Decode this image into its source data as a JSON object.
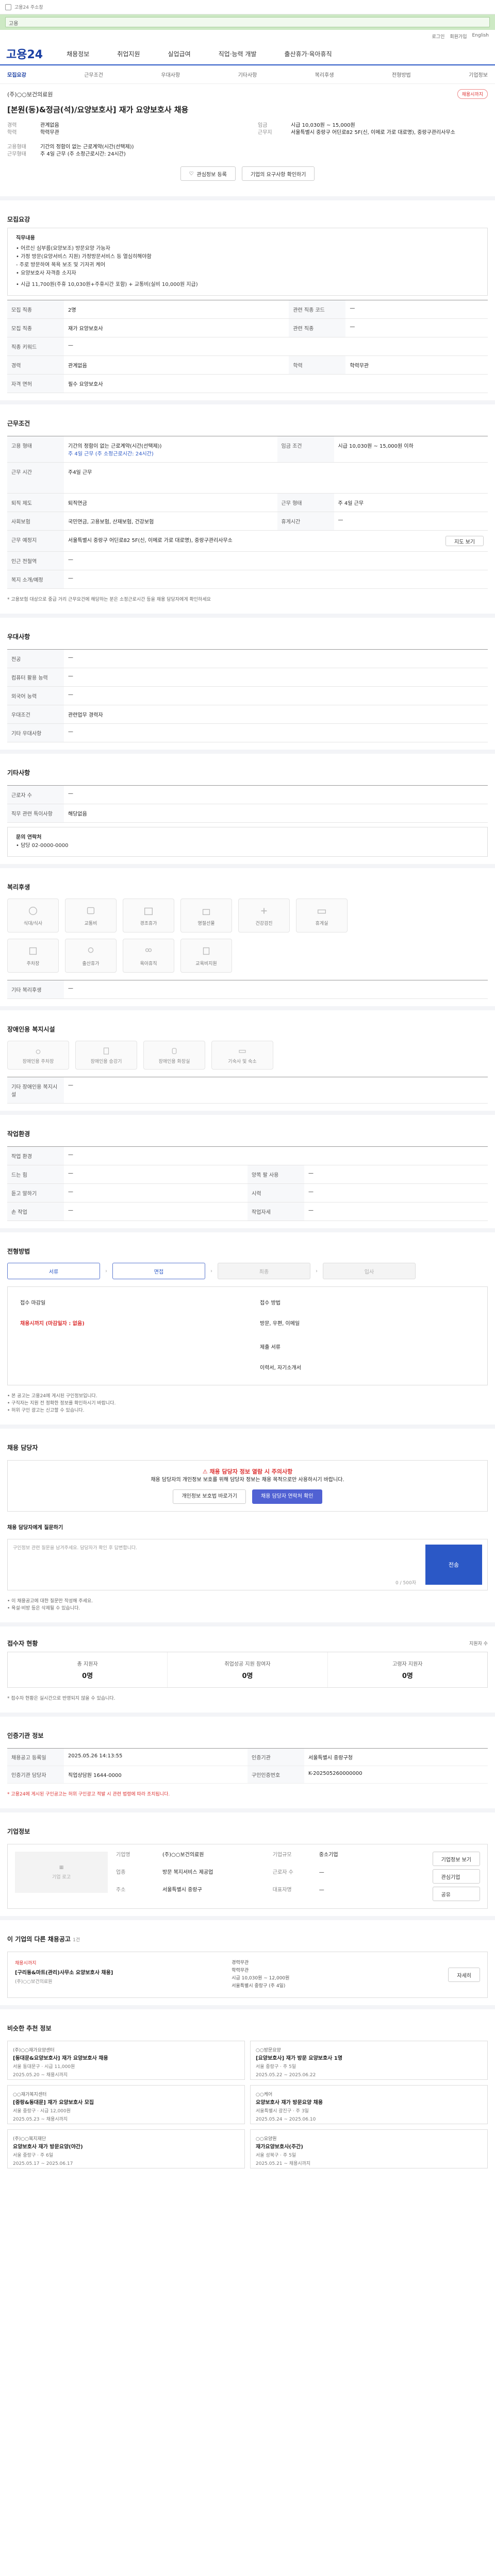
{
  "topbar": {
    "label": "고용24 주소창"
  },
  "green": {
    "text": "고용"
  },
  "util": {
    "items": [
      "로그인",
      "회원가입",
      "English"
    ]
  },
  "gnb": {
    "logo": "고용24",
    "menu": [
      "채용정보",
      "취업지원",
      "실업급여",
      "직업·능력 개발",
      "출산휴가·육아휴직"
    ]
  },
  "subtabs": {
    "items": [
      "모집요강",
      "근무조건",
      "우대사항",
      "기타사항",
      "복리후생",
      "전형방법",
      "기업정보"
    ]
  },
  "header": {
    "company": "(주)○○보건의료원",
    "badge": "채용시까지",
    "title": "[본원(동)&정금(석)/요양보호사] 재가 요양보호사 채용"
  },
  "summary": {
    "left": [
      {
        "k": "경력",
        "v": "관계없음"
      },
      {
        "k": "학력",
        "v": "학력무관"
      },
      {
        "k": "고용형태",
        "v": "기간의 정함이 없는 근로계약(시간(선택제))"
      },
      {
        "k": "근무형태",
        "v": "주 4일 근무 (주 소정근로시간: 24시간)"
      }
    ],
    "right": [
      {
        "k": "임금",
        "v": "시급 10,030원 ~ 15,000원"
      },
      {
        "k": "근무지",
        "v": "서울특별시 중랑구 어딘로82 5F(신, 이메로 가로 대로명), 중랑구관리사무소"
      }
    ]
  },
  "buttons": {
    "save": "관심정보 등록",
    "share": "기업의 요구사항 확인하기"
  },
  "recruit": {
    "title": "모집요강",
    "duty_title": "직무내용",
    "duty_lines": [
      "• 어르신 심부름(요양보조) 방문요양 가능자",
      "• 가정 방문(요양서비스 지원) 가정방문서비스 등 열심히해야함",
      "- 주로 방문하여 목욕 보조 및 기저귀 케어",
      "• 요양보호사 자격증 소지자",
      "• 시급 11,700원(주휴 10,030원+주휴시간 포함) + 교통비(실비 10,000원 지급)"
    ],
    "rows": [
      {
        "k": "모집 직종",
        "v": "2명",
        "k2": "관련 직종 코드",
        "v2": "—"
      },
      {
        "k": "모집 직종",
        "v": "재가 요양보호사",
        "k2": "관련 직종",
        "v2": "—"
      },
      {
        "k": "직종 키워드",
        "v": "—",
        "k2": "",
        "v2": ""
      },
      {
        "k": "경력",
        "v": "관계없음",
        "k2": "학력",
        "v2": "학력무관"
      },
      {
        "k": "자격 면허",
        "v": "필수  요양보호사",
        "k2": "",
        "v2": ""
      }
    ]
  },
  "workcond": {
    "title": "근무조건",
    "rows": [
      {
        "k": "고용 형태",
        "v": "기간의 정함이 없는 근로계약(시간(선택제))",
        "k2": "임금 조건",
        "v2": "시급 10,030원 ~ 15,000원 이하"
      },
      {
        "k": "",
        "v": "주 4일 근무 (주 소정근로시간: 24시간)",
        "k2": "",
        "v2": ""
      },
      {
        "k": "근무 시간",
        "v": "주4일 근무",
        "k2": "",
        "v2": ""
      },
      {
        "k": "퇴직 제도",
        "v": "퇴직연금",
        "k2": "근무 형태",
        "v2": "주 4일 근무"
      },
      {
        "k": "사회보험",
        "v": "국민연금, 고용보험, 산재보험, 건강보험",
        "k2": "휴게시간",
        "v2": "—"
      },
      {
        "k": "근무 예정지",
        "v": "서울특별시 중랑구 어딘로82 5F(신, 이메로 가로 대로명), 중랑구관리사무소",
        "k2": "",
        "v2": "지도 보기"
      },
      {
        "k": "인근 전철역",
        "v": "—",
        "k2": "",
        "v2": ""
      },
      {
        "k": "복지 소개/예정",
        "v": "—",
        "k2": "",
        "v2": ""
      }
    ],
    "note": "* 고용보험 대상으로 중급 거리 근무요건에 해당하는 분은 소정근로시간 등을 채용 담당자에게 확인하세요"
  },
  "pref": {
    "title": "우대사항",
    "rows": [
      {
        "k": "전공",
        "v": "—"
      },
      {
        "k": "컴퓨터 활용 능력",
        "v": "—"
      },
      {
        "k": "외국어 능력",
        "v": "—"
      },
      {
        "k": "우대조건",
        "v": "관련업무 경력자"
      },
      {
        "k": "기타 우대사항",
        "v": "—"
      }
    ]
  },
  "etc": {
    "title": "기타사항",
    "rows": [
      {
        "k": "근로자 수",
        "v": "—"
      },
      {
        "k": "직무 관련 특이사항",
        "v": "해당없음"
      }
    ],
    "contact_label": "문의 연락처",
    "contact": "• 담당 02-0000-0000"
  },
  "welfare": {
    "title": "복리후생",
    "items": [
      "식대/식사",
      "교통비",
      "경조휴가",
      "명절선물",
      "건강검진",
      "휴게실",
      "주차장",
      "출산휴가",
      "육아휴직",
      "교육비지원",
      "",
      ""
    ],
    "extra_label": "기타 복리후생",
    "extra": "—"
  },
  "disable": {
    "title": "장애인용 복지시설",
    "items": [
      "장애인용 주차장",
      "장애인용 승강기",
      "장애인용 화장실",
      "기숙사 및 숙소"
    ],
    "extra_label": "기타 장애인용 복지시설",
    "extra": "—"
  },
  "workenv": {
    "title": "작업환경",
    "rows": [
      {
        "k": "작업 환경",
        "v": "—",
        "k2": "",
        "v2": ""
      },
      {
        "k": "드는 힘",
        "v": "—",
        "k2": "양쪽 팔 사용",
        "v2": "—"
      },
      {
        "k": "듣고 말하기",
        "v": "—",
        "k2": "시력",
        "v2": "—"
      },
      {
        "k": "손 작업",
        "v": "—",
        "k2": "작업자세",
        "v2": "—"
      }
    ]
  },
  "screen": {
    "title": "전형방법",
    "steps": [
      "서류",
      "면접",
      "최종",
      "입사"
    ],
    "deadline_label": "접수 마감일",
    "deadline": "채용시까지 (마감일자 : 없음)",
    "method_label": "접수 방법",
    "method": "방문, 우편, 이메일",
    "docs_label": "제출 서류",
    "docs": "이력서, 자기소개서",
    "notes": [
      "• 본 공고는 고용24에 게시된 구인정보입니다.",
      "• 구직자는 지원 전 정확한 정보를 확인하시기 바랍니다.",
      "• 허위 구인 광고는 신고할 수 있습니다."
    ]
  },
  "contact": {
    "title": "채용 담당자",
    "alert": "채용 담당자 정보 열람 시 주의사항",
    "alert_body": "채용 담당자의 개인정보 보호를 위해 담당자 정보는 채용 목적으로만 사용하시기 바랍니다.",
    "btn1": "개인정보 보호법 바로가기",
    "btn2": "채용 담당자 연락처 확인"
  },
  "inquiry": {
    "title": "채용 담당자에게 질문하기",
    "placeholder": "구인정보 관련 질문을 남겨주세요. 담당자가 확인 후 답변합니다.",
    "counter": "0 / 500자",
    "send": "전송",
    "notes": [
      "• 이 채용공고에 대한 질문만 작성해 주세요.",
      "• 욕설·비방 등은 삭제될 수 있습니다."
    ]
  },
  "status": {
    "title": "접수자 현황",
    "more": "지원자 수",
    "items": [
      {
        "k": "총 지원자",
        "v": "0명"
      },
      {
        "k": "취업성공 지원 참여자",
        "v": "0명"
      },
      {
        "k": "고령자 지원자",
        "v": "0명"
      }
    ],
    "note": "* 접수자 현황은 실시간으로 반영되지 않을 수 있습니다."
  },
  "reginfo": {
    "title": "인증기관 정보",
    "rows": [
      {
        "k": "채용공고 등록일",
        "v": "2025.05.26 14:13:55",
        "k2": "인증기관",
        "v2": "서울특별시 중랑구청"
      },
      {
        "k": "인증기관 담당자",
        "v": "직업상담원 1644-0000",
        "k2": "구인인증번호",
        "v2": "K-202505260000000"
      }
    ],
    "note": "* 고용24에 게시된 구인공고는 허위 구인광고 적발 시 관련 법령에 따라 조치됩니다."
  },
  "company": {
    "title": "기업정보",
    "logo_label": "기업 로고",
    "name_k": "기업명",
    "name_v": "(주)○○보건의료원",
    "biz_k": "업종",
    "biz_v": "방문 복지서비스 제공업",
    "size_k": "기업규모",
    "size_v": "중소기업",
    "emp_k": "근로자 수",
    "emp_v": "—",
    "addr_k": "주소",
    "addr_v": "서울특별시 중랑구",
    "rep_k": "대표자명",
    "rep_v": "—",
    "btn1": "기업정보 보기",
    "btn2": "관심기업",
    "btn3": "공유"
  },
  "other": {
    "title": "이 기업의 다른 채용공고",
    "count": "1건",
    "co": "(주)○○보건의료원",
    "label": "채용시까지",
    "job": "[구리동&마트(관리)사무소 요양보호사 채용]",
    "meta": [
      "경력무관",
      "학력무관",
      "시급 10,030원 ~ 12,000원",
      "서울특별시 중랑구 (주 4일)"
    ],
    "btn": "자세히"
  },
  "recs": {
    "title": "비슷한 추천 정보",
    "items": [
      {
        "co": "(주)○○재가요양센터",
        "t": "[동대문&요양보호사] 재가 요양보호사 채용",
        "m": "서울 동대문구 · 시급 11,000원",
        "d": "2025.05.20 ~ 채용시까지"
      },
      {
        "co": "○○방문요양",
        "t": "[요양보호사] 재가 방문 요양보호사 1명",
        "m": "서울 중랑구 · 주 5일",
        "d": "2025.05.22 ~ 2025.06.22"
      },
      {
        "co": "○○재가복지센터",
        "t": "[중랑&동대문] 재가 요양보호사 모집",
        "m": "서울 중랑구 · 시급 12,000원",
        "d": "2025.05.23 ~ 채용시까지"
      },
      {
        "co": "○○케어",
        "t": "요양보호사 재가 방문요양 채용",
        "m": "서울특별시 광진구 · 주 3일",
        "d": "2025.05.24 ~ 2025.06.10"
      },
      {
        "co": "(주)○○복지재단",
        "t": "요양보호사 재가 방문요양(야간)",
        "m": "서울 중랑구 · 주 6일",
        "d": "2025.05.17 ~ 2025.06.17"
      },
      {
        "co": "○○요양원",
        "t": "재가요양보호사(주간)",
        "m": "서울 성북구 · 주 5일",
        "d": "2025.05.21 ~ 채용시까지"
      }
    ]
  }
}
